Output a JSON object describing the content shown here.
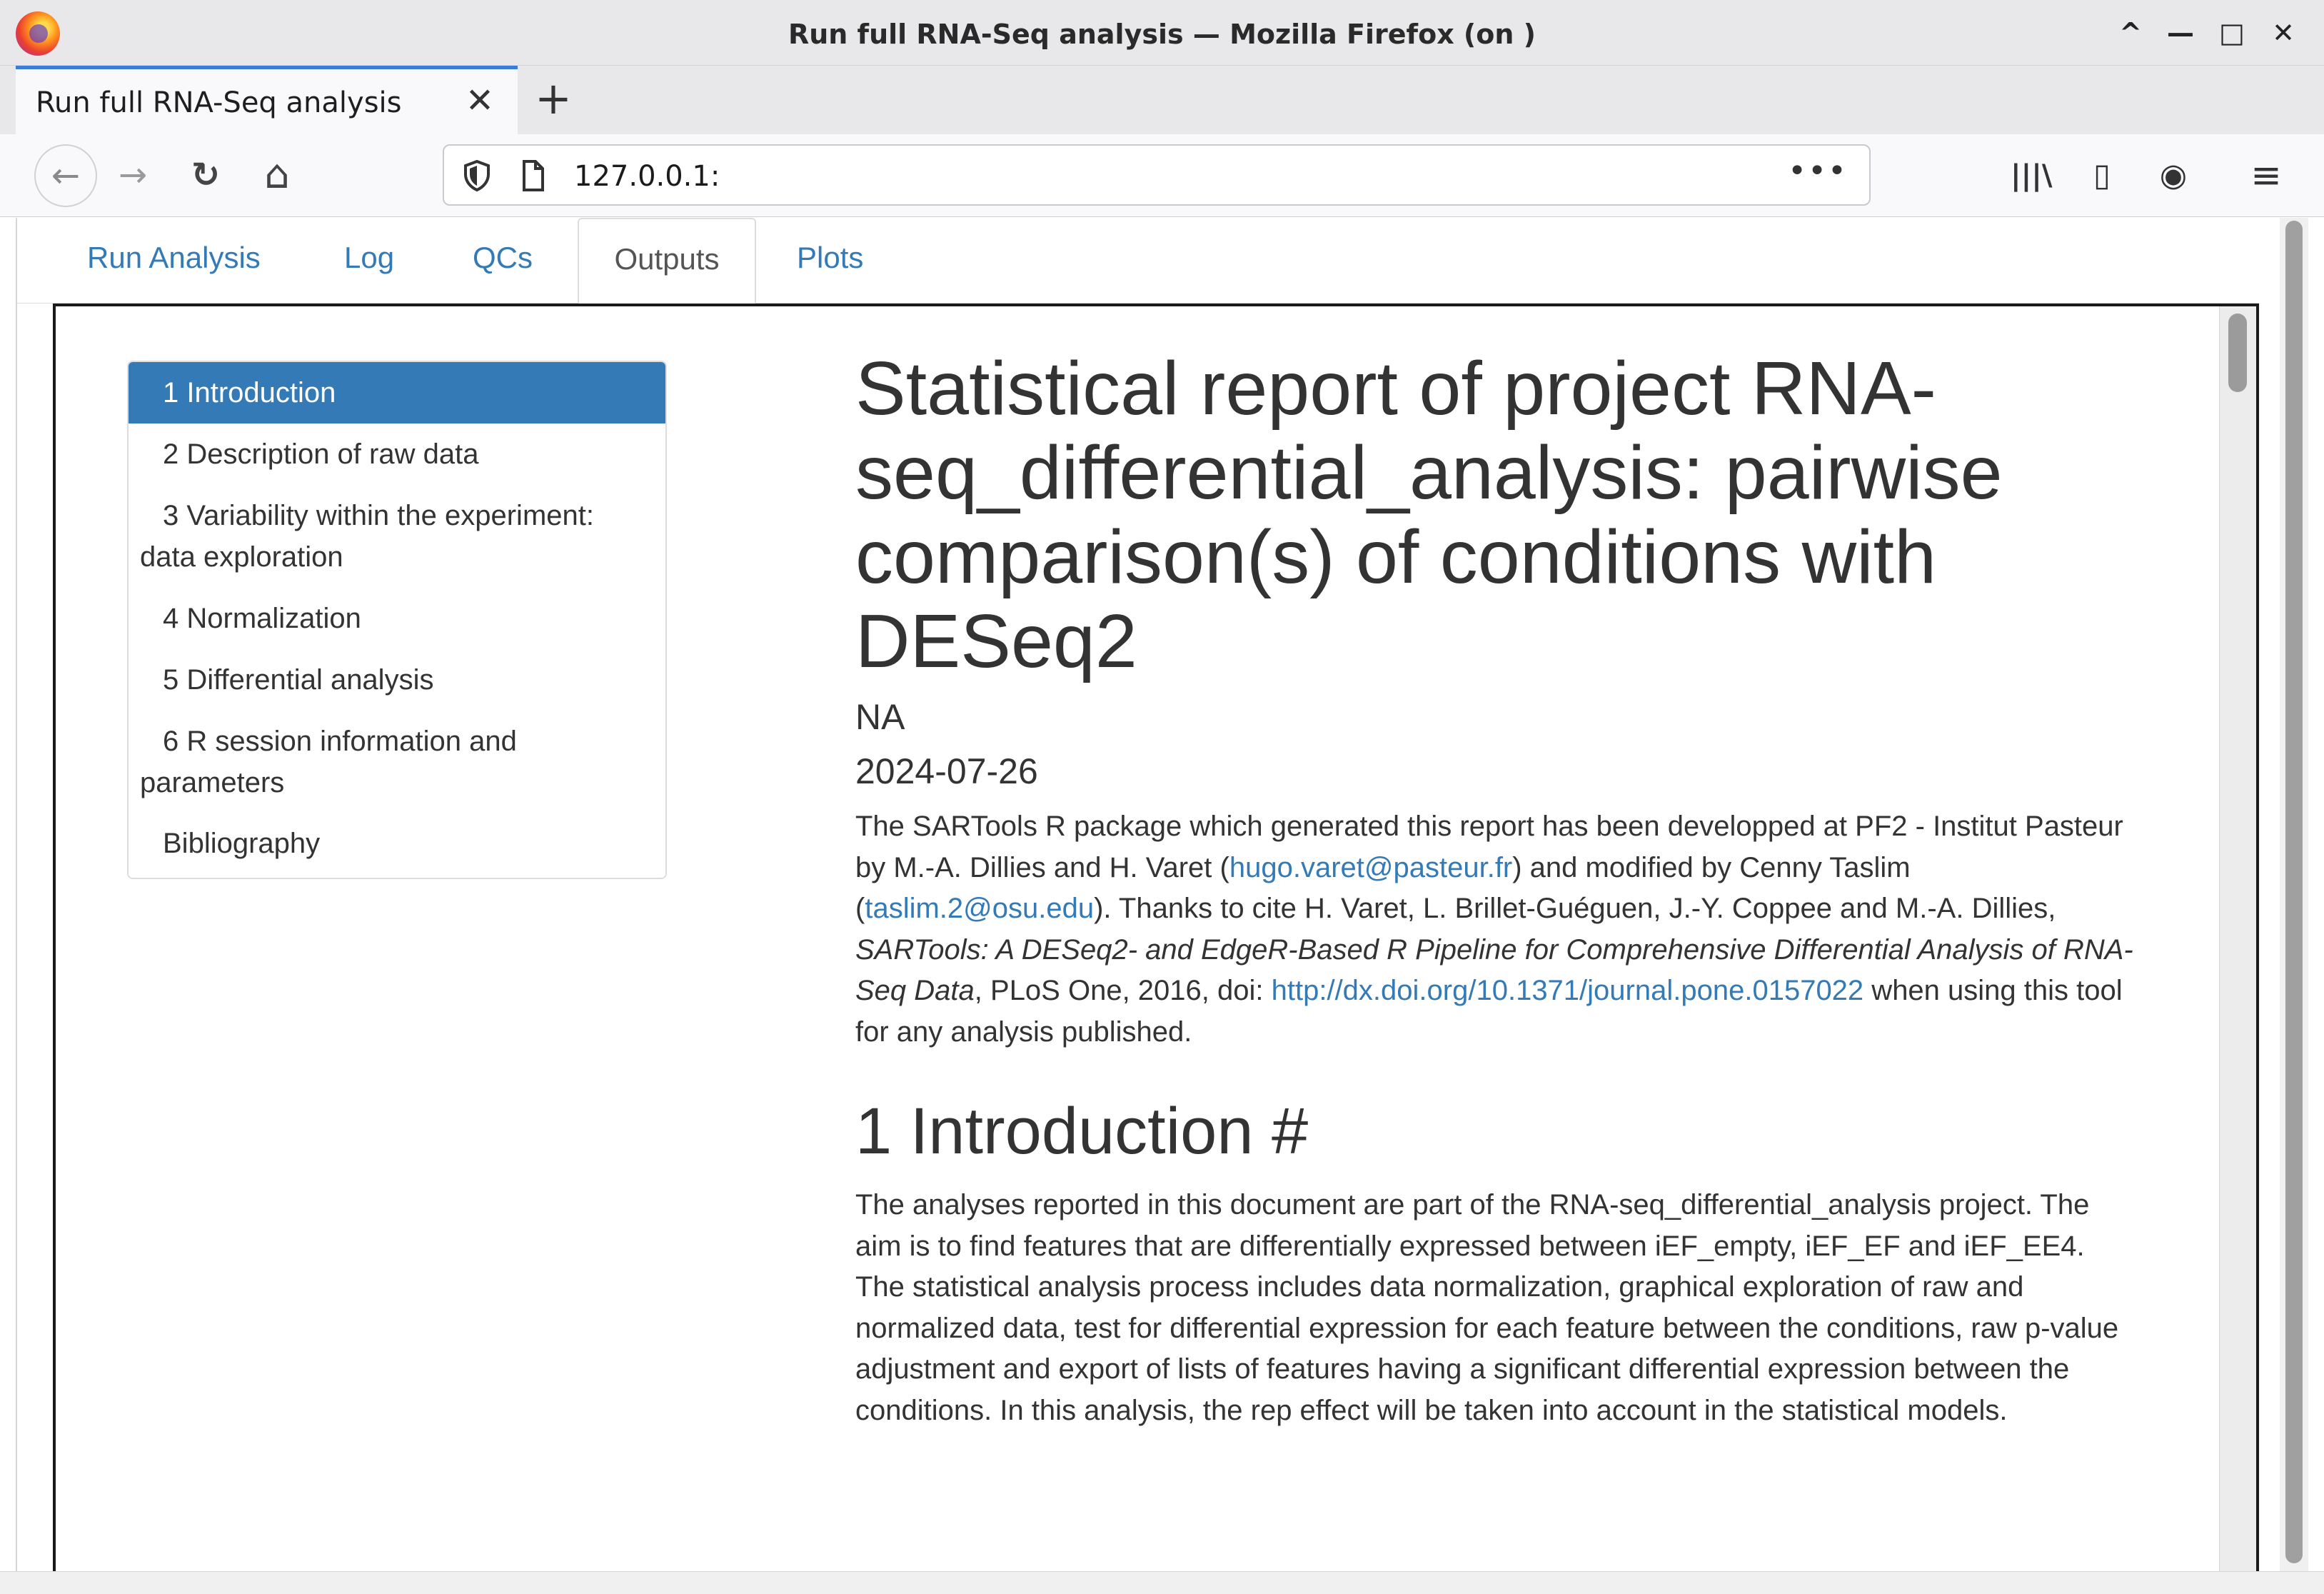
{
  "window": {
    "title": "Run full RNA-Seq analysis — Mozilla Firefox (on                     )",
    "controls": {
      "up": "^",
      "minimize": "—",
      "maximize": "□",
      "close": "✕"
    }
  },
  "browser_tab": {
    "label": "Run full RNA-Seq analysis",
    "close": "✕",
    "new_tab": "+"
  },
  "nav": {
    "back": "←",
    "forward": "→",
    "reload": "↻",
    "home": "⌂",
    "url": "127.0.0.1:",
    "more": "•••",
    "library": "|||\\",
    "sidebar": "▯",
    "account": "◉",
    "menu": "≡"
  },
  "app_tabs": [
    "Run Analysis",
    "Log",
    "QCs",
    "Outputs",
    "Plots"
  ],
  "active_app_tab": "Outputs",
  "toc": {
    "items": [
      "1 Introduction",
      "2 Description of raw data",
      "3 Variability within the experiment:",
      "data exploration",
      "4 Normalization",
      "5 Differential analysis",
      "6 R session information and",
      "parameters",
      "Bibliography"
    ],
    "active_index": 0
  },
  "report": {
    "title": "Statistical report of project RNA-seq_differential_analysis: pairwise comparison(s) of conditions with DESeq2",
    "author": "NA",
    "date": "2024-07-26",
    "credits": {
      "p1": "The SARTools R package which generated this report has been developped at PF2 - Institut Pasteur by M.-A. Dillies and H. Varet (",
      "email1": "hugo.varet@pasteur.fr",
      "p2": ") and modified by Cenny Taslim (",
      "email2": "taslim.2@osu.edu",
      "p3": "). Thanks to cite H. Varet, L. Brillet-Guéguen, J.-Y. Coppee and M.-A. Dillies, ",
      "citation_title": "SARTools: A DESeq2- and EdgeR-Based R Pipeline for Comprehensive Differential Analysis of RNA-Seq Data",
      "p4": ", PLoS One, 2016, doi: ",
      "doi_link": "http://dx.doi.org/10.1371/journal.pone.0157022",
      "p5": " when using this tool for any analysis published."
    },
    "section_heading": "1 Introduction #",
    "intro_text": "The analyses reported in this document are part of the RNA-seq_differential_analysis project. The aim is to find features that are differentially expressed between iEF_empty, iEF_EF and iEF_EE4. The statistical analysis process includes data normalization, graphical exploration of raw and normalized data, test for differential expression for each feature between the conditions, raw p-value adjustment and export of lists of features having a significant differential expression between the conditions. In this analysis, the rep effect will be taken into account in the statistical models."
  },
  "colors": {
    "link": "#337ab7",
    "toc_active": "#337ab7",
    "firefox_tab_accent": "#3a7bd5"
  }
}
